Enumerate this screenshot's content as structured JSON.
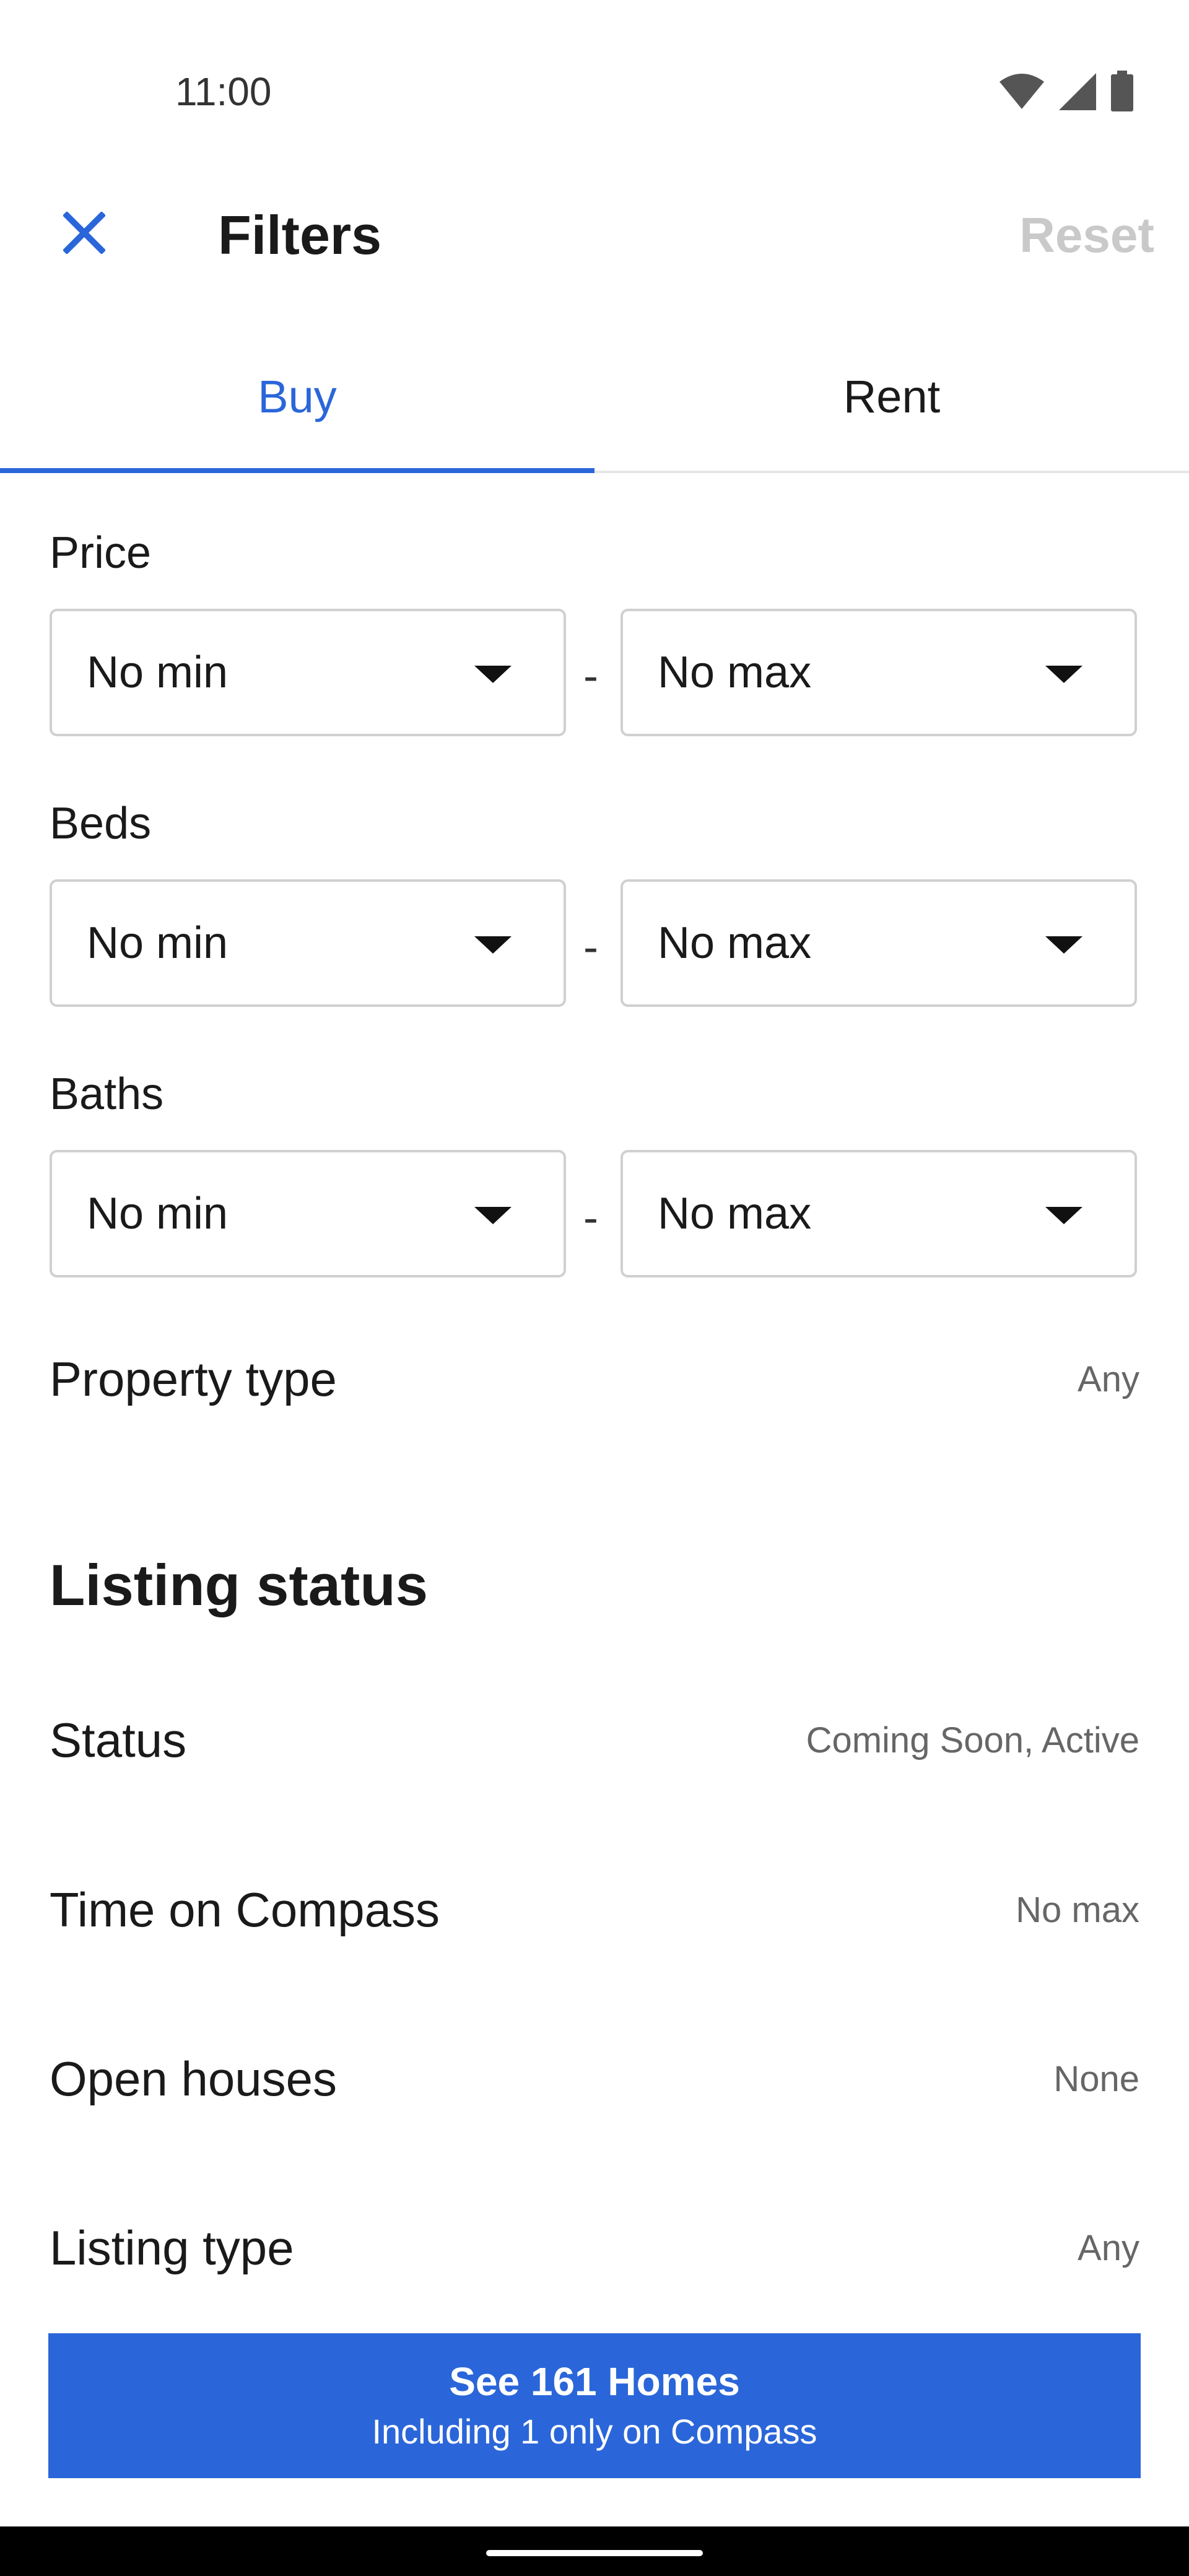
{
  "status_bar": {
    "time": "11:00"
  },
  "header": {
    "title": "Filters",
    "reset_label": "Reset"
  },
  "tabs": [
    {
      "label": "Buy",
      "active": true
    },
    {
      "label": "Rent",
      "active": false
    }
  ],
  "price": {
    "label": "Price",
    "min": "No min",
    "max": "No max",
    "separator": "-"
  },
  "beds": {
    "label": "Beds",
    "min": "No min",
    "max": "No max",
    "separator": "-"
  },
  "baths": {
    "label": "Baths",
    "min": "No min",
    "max": "No max",
    "separator": "-"
  },
  "property_type": {
    "label": "Property type",
    "value": "Any"
  },
  "listing_status": {
    "title": "Listing status",
    "rows": [
      {
        "label": "Status",
        "value": "Coming Soon, Active"
      },
      {
        "label": "Time on Compass",
        "value": "No max"
      },
      {
        "label": "Open houses",
        "value": "None"
      },
      {
        "label": "Listing type",
        "value": "Any"
      }
    ]
  },
  "cta": {
    "line1": "See 161 Homes",
    "line2": "Including 1 only on Compass"
  },
  "colors": {
    "accent": "#2a66d9",
    "reset_disabled": "#c9c9c9"
  },
  "icons": {
    "close": "close-icon",
    "wifi": "wifi-icon",
    "signal": "signal-icon",
    "battery": "battery-icon",
    "dropdown": "caret-down-icon"
  }
}
